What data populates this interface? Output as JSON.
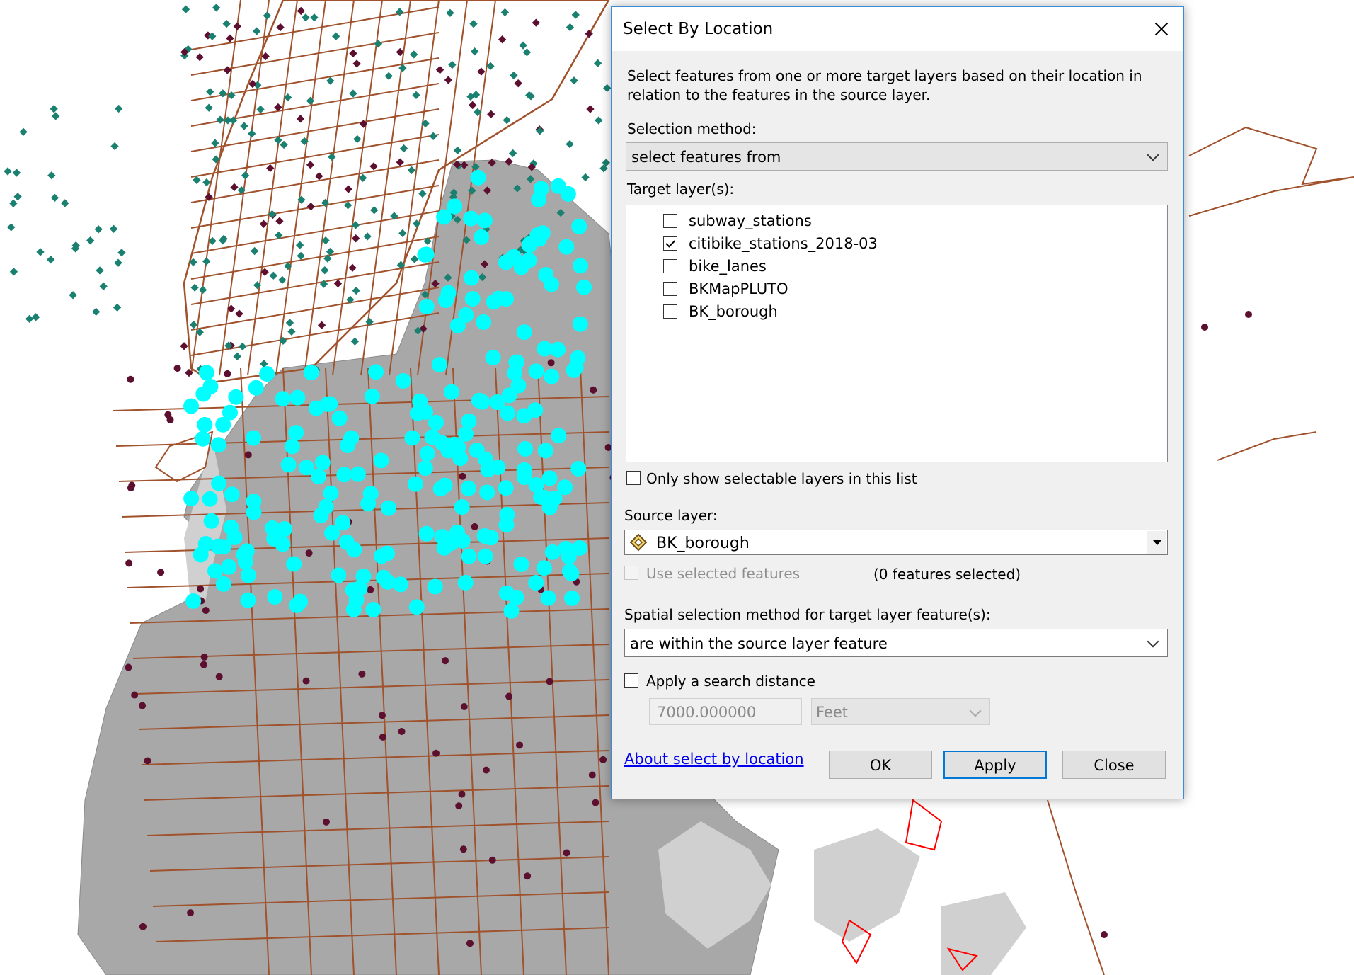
{
  "map": {
    "colors": {
      "land": "#a8a8a8",
      "land_light": "#d0d0d0",
      "streets": "#a0522d",
      "selected_stations": "#00ffff",
      "subway_stations": "#5c0f2f",
      "manhattan_points": "#1a8070",
      "water_features": "#ff0000"
    }
  },
  "dialog": {
    "title": "Select By Location",
    "description": "Select features from one or more target layers based on their location in relation to the features in the source layer.",
    "selection_method_label": "Selection method:",
    "selection_method_value": "select features from",
    "target_layers_label": "Target layer(s):",
    "target_layers": [
      {
        "name": "subway_stations",
        "checked": false
      },
      {
        "name": "citibike_stations_2018-03",
        "checked": true
      },
      {
        "name": "bike_lanes",
        "checked": false
      },
      {
        "name": "BKMapPLUTO",
        "checked": false
      },
      {
        "name": "BK_borough",
        "checked": false
      }
    ],
    "only_selectable_label": "Only show selectable layers in this list",
    "source_layer_label": "Source layer:",
    "source_layer_value": "BK_borough",
    "source_layer_icon": "polygon-layer-icon",
    "use_selected_label": "Use selected features",
    "features_selected": "(0 features selected)",
    "spatial_method_label": "Spatial selection method for target layer feature(s):",
    "spatial_method_value": "are within the source layer feature",
    "search_distance_label": "Apply a search distance",
    "search_distance_value": "7000.000000",
    "search_distance_unit": "Feet",
    "about_link": "About select by location",
    "buttons": {
      "ok": "OK",
      "apply": "Apply",
      "close": "Close"
    }
  }
}
